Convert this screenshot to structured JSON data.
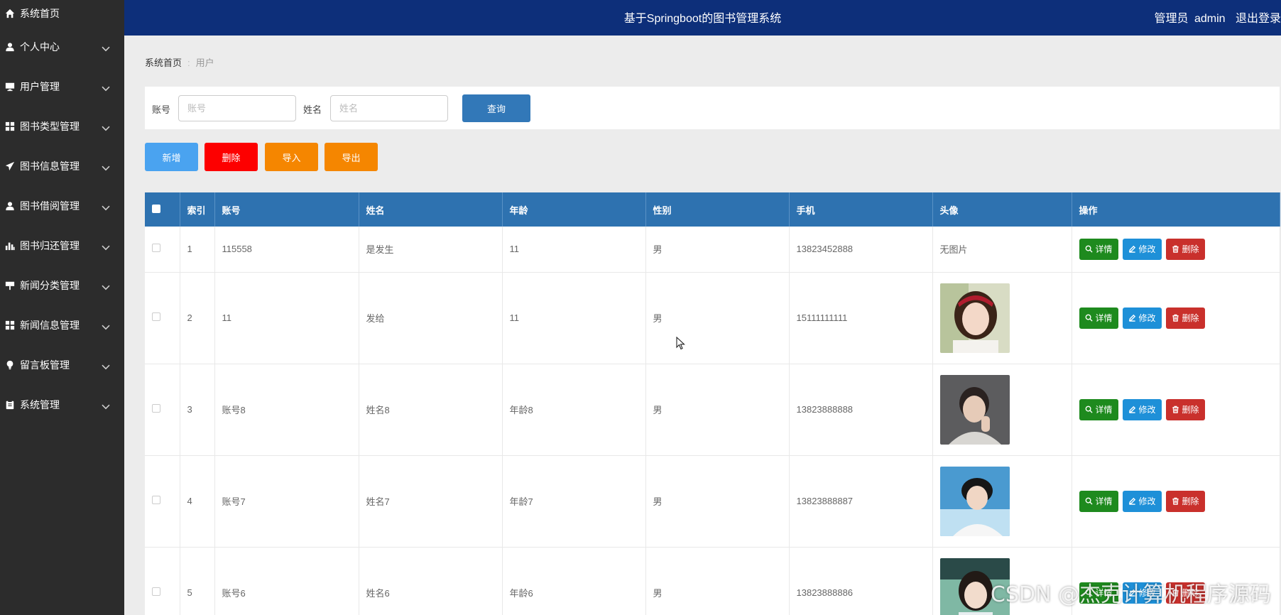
{
  "header": {
    "title": "基于Springboot的图书管理系统",
    "role": "管理员",
    "user": "admin",
    "logout": "退出登录"
  },
  "sidebar": {
    "items": [
      {
        "label": "系统首页",
        "icon": "home-icon"
      },
      {
        "label": "个人中心",
        "icon": "user-icon"
      },
      {
        "label": "用户管理",
        "icon": "monitor-icon"
      },
      {
        "label": "图书类型管理",
        "icon": "grid-icon"
      },
      {
        "label": "图书信息管理",
        "icon": "send-icon"
      },
      {
        "label": "图书借阅管理",
        "icon": "user-icon"
      },
      {
        "label": "图书归还管理",
        "icon": "bar-chart-icon"
      },
      {
        "label": "新闻分类管理",
        "icon": "signpost-icon"
      },
      {
        "label": "新闻信息管理",
        "icon": "grid-icon"
      },
      {
        "label": "留言板管理",
        "icon": "bulb-icon"
      },
      {
        "label": "系统管理",
        "icon": "clipboard-icon"
      }
    ]
  },
  "breadcrumb": {
    "home": "系统首页",
    "current": "用户"
  },
  "search": {
    "account_label": "账号",
    "account_placeholder": "账号",
    "name_label": "姓名",
    "name_placeholder": "姓名",
    "query_button": "查询"
  },
  "actions": {
    "add": {
      "label": "新增",
      "color": "#4aa3f0"
    },
    "delete": {
      "label": "删除",
      "color": "#fd0000"
    },
    "import": {
      "label": "导入",
      "color": "#f58600"
    },
    "export": {
      "label": "导出",
      "color": "#f58600"
    }
  },
  "table": {
    "columns": [
      "索引",
      "账号",
      "姓名",
      "年龄",
      "性别",
      "手机",
      "头像",
      "操作"
    ],
    "rows": [
      {
        "index": "1",
        "account": "115558",
        "name": "是发生",
        "age": "11",
        "gender": "男",
        "phone": "13823452888",
        "avatar": "无图片",
        "avatar_kind": "none"
      },
      {
        "index": "2",
        "account": "11",
        "name": "发给",
        "age": "11",
        "gender": "男",
        "phone": "15111111111",
        "avatar": "",
        "avatar_kind": "girl-red-headband"
      },
      {
        "index": "3",
        "account": "账号8",
        "name": "姓名8",
        "age": "年龄8",
        "gender": "男",
        "phone": "13823888888",
        "avatar": "",
        "avatar_kind": "boy-grey"
      },
      {
        "index": "4",
        "account": "账号7",
        "name": "姓名7",
        "age": "年龄7",
        "gender": "男",
        "phone": "13823888887",
        "avatar": "",
        "avatar_kind": "boy-blue"
      },
      {
        "index": "5",
        "account": "账号6",
        "name": "姓名6",
        "age": "年龄6",
        "gender": "男",
        "phone": "13823888886",
        "avatar": "",
        "avatar_kind": "girl-green"
      }
    ],
    "ops": {
      "detail": "详情",
      "edit": "修改",
      "delete": "删除"
    }
  },
  "watermark": "CSDN @杰克计算机程序源码"
}
